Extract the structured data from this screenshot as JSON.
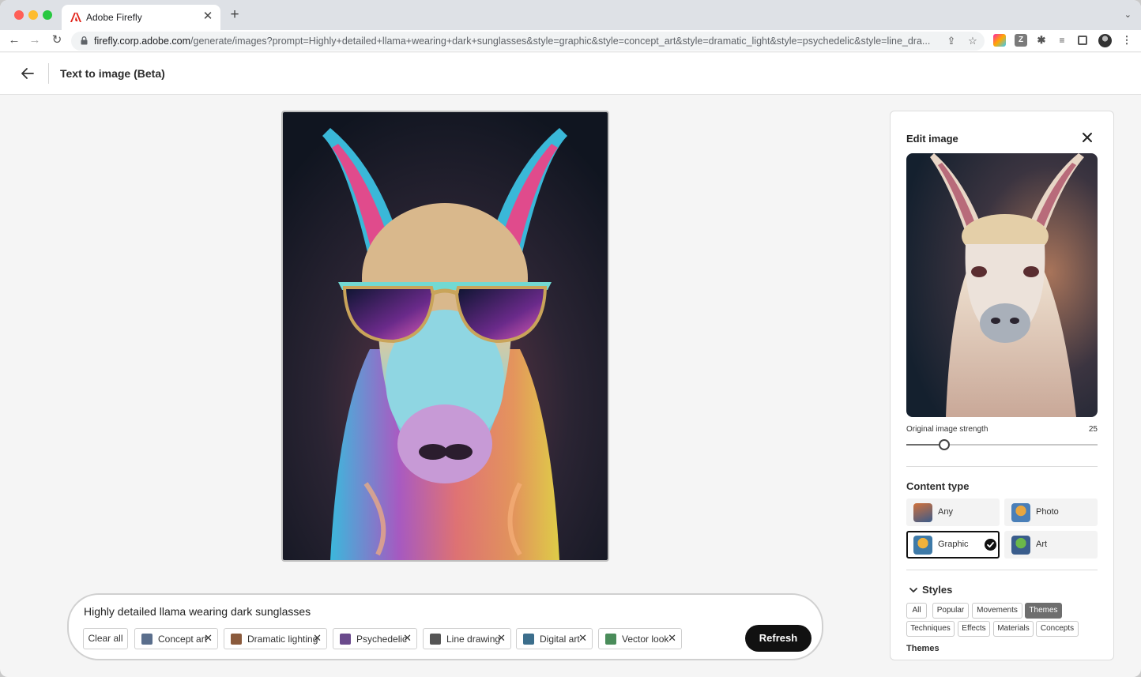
{
  "browser": {
    "tab_title": "Adobe Firefly",
    "url_host": "firefly.corp.adobe.com",
    "url_path": "/generate/images?prompt=Highly+detailed+llama+wearing+dark+sunglasses&style=graphic&style=concept_art&style=dramatic_light&style=psychedelic&style=line_dra..."
  },
  "header": {
    "title": "Text to image (Beta)"
  },
  "prompt": {
    "text": "Highly detailed llama wearing dark sunglasses",
    "clear_all_label": "Clear all",
    "chips": [
      {
        "label": "Concept art",
        "thumb_color": "#5a6e8c"
      },
      {
        "label": "Dramatic lighting",
        "thumb_color": "#8a5a3c"
      },
      {
        "label": "Psychedelic",
        "thumb_color": "#6a4a8c"
      },
      {
        "label": "Line drawing",
        "thumb_color": "#555555"
      },
      {
        "label": "Digital art",
        "thumb_color": "#3c6e8c"
      },
      {
        "label": "Vector look",
        "thumb_color": "#4a8c5a"
      }
    ],
    "refresh_label": "Refresh"
  },
  "edit_panel": {
    "title": "Edit image",
    "strength_label": "Original image strength",
    "strength_value": "25",
    "strength_fraction": 0.2,
    "content_type_title": "Content type",
    "content_types": [
      {
        "label": "Any",
        "selected": false
      },
      {
        "label": "Photo",
        "selected": false
      },
      {
        "label": "Graphic",
        "selected": true
      },
      {
        "label": "Art",
        "selected": false
      }
    ],
    "styles_title": "Styles",
    "style_filters": [
      {
        "label": "All",
        "active": false
      },
      {
        "label": "Popular",
        "active": false
      },
      {
        "label": "Movements",
        "active": false
      },
      {
        "label": "Themes",
        "active": true
      },
      {
        "label": "Techniques",
        "active": false
      },
      {
        "label": "Effects",
        "active": false
      },
      {
        "label": "Materials",
        "active": false
      },
      {
        "label": "Concepts",
        "active": false
      }
    ],
    "themes_title": "Themes"
  },
  "colors": {
    "accent_dark": "#111111",
    "adobe_red": "#e1251b"
  }
}
